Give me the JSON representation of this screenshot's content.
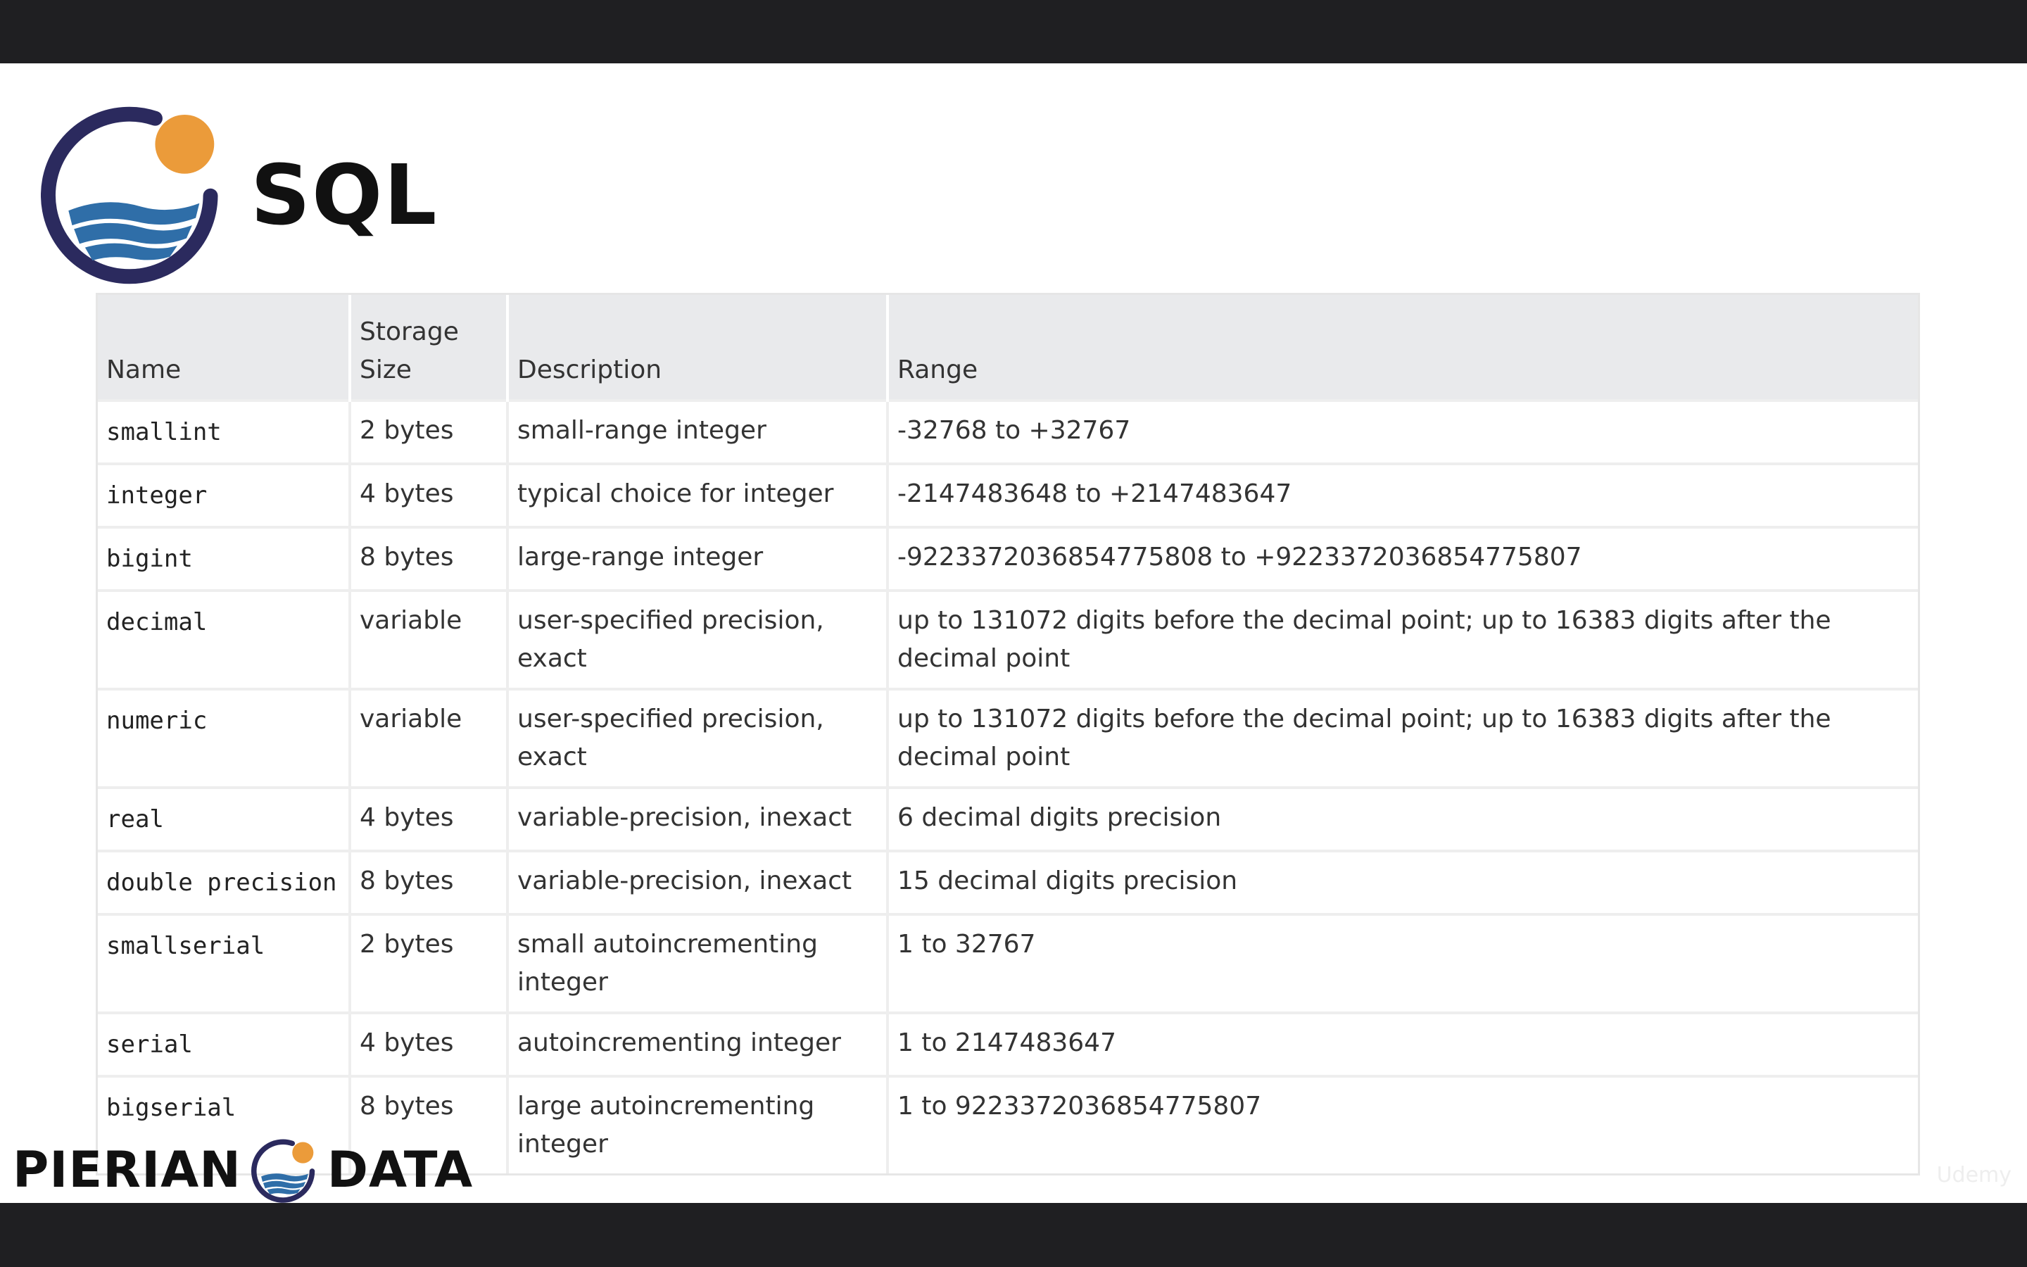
{
  "header": {
    "title": "SQL"
  },
  "table": {
    "columns": [
      "Name",
      "Storage Size",
      "Description",
      "Range"
    ],
    "rows": [
      {
        "name": "smallint",
        "size": "2 bytes",
        "description": "small-range integer",
        "range": "-32768 to +32767"
      },
      {
        "name": "integer",
        "size": "4 bytes",
        "description": "typical choice for integer",
        "range": "-2147483648 to +2147483647"
      },
      {
        "name": "bigint",
        "size": "8 bytes",
        "description": "large-range integer",
        "range": "-9223372036854775808 to +9223372036854775807"
      },
      {
        "name": "decimal",
        "size": "variable",
        "description": "user-specified precision, exact",
        "range": "up to 131072 digits before the decimal point; up to 16383 digits after the decimal point"
      },
      {
        "name": "numeric",
        "size": "variable",
        "description": "user-specified precision, exact",
        "range": "up to 131072 digits before the decimal point; up to 16383 digits after the decimal point"
      },
      {
        "name": "real",
        "size": "4 bytes",
        "description": "variable-precision, inexact",
        "range": "6 decimal digits precision"
      },
      {
        "name": "double precision",
        "size": "8 bytes",
        "description": "variable-precision, inexact",
        "range": "15 decimal digits precision"
      },
      {
        "name": "smallserial",
        "size": "2 bytes",
        "description": "small autoincrementing integer",
        "range": "1 to 32767"
      },
      {
        "name": "serial",
        "size": "4 bytes",
        "description": "autoincrementing integer",
        "range": "1 to 2147483647"
      },
      {
        "name": "bigserial",
        "size": "8 bytes",
        "description": "large autoincrementing integer",
        "range": "1 to 9223372036854775807"
      }
    ]
  },
  "footer": {
    "brand_left": "PIERIAN",
    "brand_right": "DATA",
    "watermark": "Udemy"
  },
  "colors": {
    "logo_navy": "#2b2a5e",
    "logo_orange": "#eb9b3a",
    "logo_blue": "#2f6ea8",
    "header_bg": "#e9eaec",
    "row_border": "#eeeeee"
  },
  "icons": {
    "main_logo": "pierian-data-logo-icon",
    "footer_logo": "pierian-data-mini-logo-icon"
  }
}
